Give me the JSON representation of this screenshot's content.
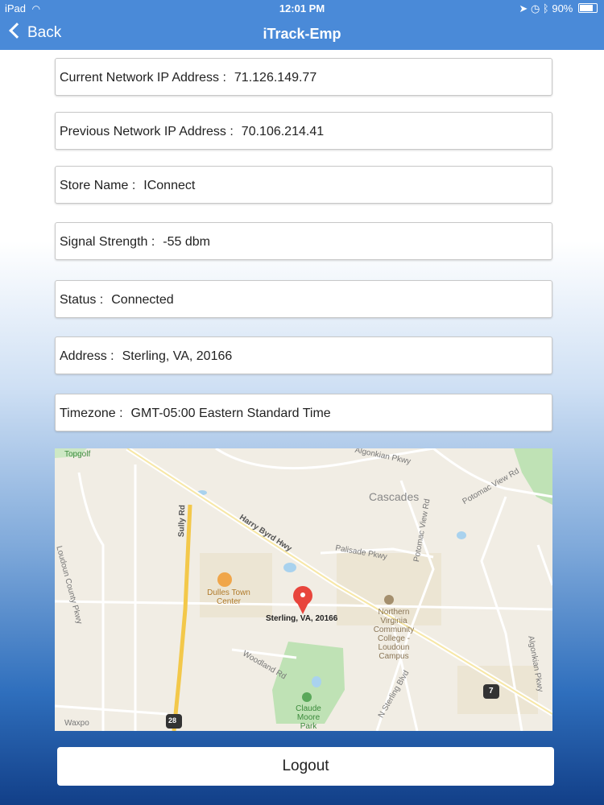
{
  "status_bar": {
    "device": "iPad",
    "time": "12:01 PM",
    "battery": "90%",
    "battery_level": 0.9
  },
  "nav": {
    "back_label": "Back",
    "title": "iTrack-Emp"
  },
  "fields": [
    {
      "label": "Current Network IP Address :",
      "value": "71.126.149.77"
    },
    {
      "label": "Previous Network IP Address :",
      "value": "70.106.214.41"
    },
    {
      "label": "Store Name :",
      "value": "IConnect"
    },
    {
      "label": "Signal Strength :",
      "value": "-55 dbm"
    },
    {
      "label": "Status :",
      "value": "Connected"
    },
    {
      "label": "Address :",
      "value": "Sterling, VA, 20166"
    },
    {
      "label": "Timezone :",
      "value": "GMT-05:00 Eastern Standard Time"
    }
  ],
  "map": {
    "pin_label": "Sterling, VA, 20166",
    "labels": {
      "topgolf": "Topgolf",
      "algonkian_top": "Algonkian Pkwy",
      "cascades": "Cascades",
      "potomac_view_top": "Potomac View Rd",
      "loudoun_county": "Loudoun County Pkwy",
      "sully": "Sully Rd",
      "harry_byrd": "Harry Byrd Hwy",
      "palisade": "Palisade Pkwy",
      "potomac_view_side": "Potomac View Rd",
      "dulles_town": "Dulles Town Center",
      "nova": "Northern Virginia Community College - Loudoun Campus",
      "woodland": "Woodland Rd",
      "n_sterling": "N Sterling Blvd",
      "algonkian_right": "Algonkian Pkwy",
      "claude_moore": "Claude Moore Park",
      "waxpool": "Waxpo",
      "route_28": "28",
      "route_7": "7"
    },
    "colors": {
      "land": "#f1ede4",
      "park": "#bfe2b5",
      "water": "#a9d2ee",
      "highway": "#f3c84a",
      "pin": "#e8453c"
    }
  },
  "logout_label": "Logout"
}
